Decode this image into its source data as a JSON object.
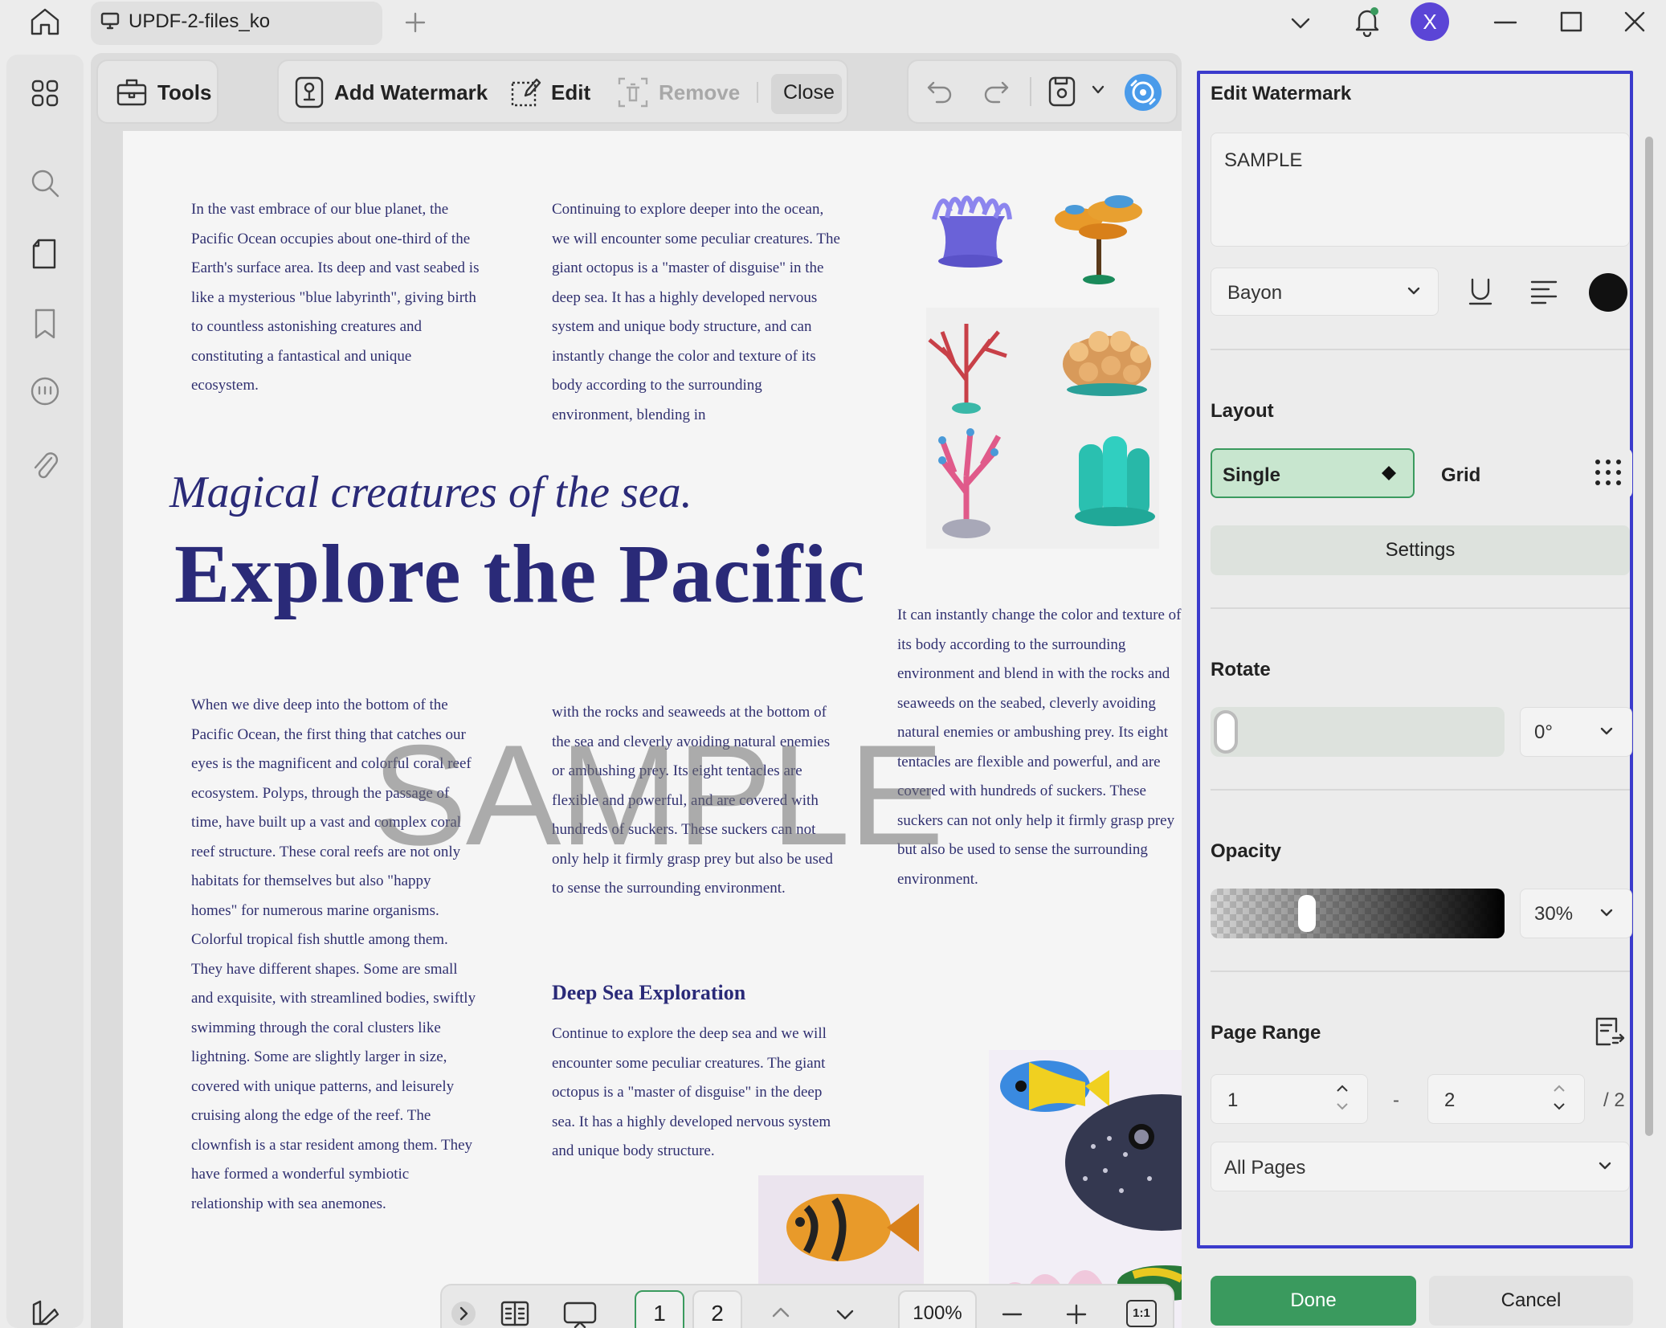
{
  "titlebar": {
    "tab_title": "UPDF-2-files_ko",
    "avatar_letter": "X"
  },
  "toolbar": {
    "tools_label": "Tools",
    "add_watermark_label": "Add Watermark",
    "edit_label": "Edit",
    "remove_label": "Remove",
    "close_label": "Close"
  },
  "document": {
    "col1_top": "In the vast embrace of our blue planet, the Pacific Ocean occupies about one-third of the Earth's surface area. Its deep and vast seabed is like a mysterious \"blue labyrinth\", giving birth to countless astonishing creatures and constituting a fantastical and unique ecosystem.",
    "col2_top": "Continuing to explore deeper into the ocean, we will encounter some peculiar creatures. The giant octopus is a \"master of disguise\" in the deep sea. It has a highly developed nervous system and unique body structure, and can instantly change the color and texture of its body according to the surrounding environment, blending in",
    "subtitle": "Magical creatures of the sea.",
    "title": "Explore the Pacific",
    "col3_mid": "It can instantly change the color and texture of its body according to the surrounding environment and blend in with the rocks and seaweeds on the seabed, cleverly avoiding natural enemies or ambushing prey. Its eight tentacles are flexible and powerful, and are covered with hundreds of suckers. These suckers can not only help it firmly grasp prey but also be used to sense the surrounding environment.",
    "col1_bottom": "When we dive deep into the bottom of the Pacific Ocean, the first thing that catches our eyes is the magnificent and colorful coral reef ecosystem. Polyps, through the passage of time, have built up a vast and complex coral reef structure. These coral reefs are not only habitats for themselves but also \"happy homes\" for numerous marine organisms. Colorful tropical fish shuttle among them. They have different shapes. Some are small and exquisite, with streamlined bodies, swiftly swimming through the coral clusters like lightning. Some are slightly larger in size, covered with unique patterns, and leisurely cruising along the edge of the reef. The clownfish is a star resident among them. They have formed a wonderful symbiotic relationship with sea anemones.",
    "col2_mid": "with the rocks and seaweeds at the bottom of the sea and cleverly avoiding natural enemies or ambushing prey. Its eight tentacles are flexible and powerful, and are covered with hundreds of suckers. These suckers can not only help it firmly grasp prey but also be used to sense the surrounding environment.",
    "section_heading": "Deep Sea Exploration",
    "col2_bottom": "Continue to explore the deep sea and we will encounter some peculiar creatures. The giant octopus is a \"master of disguise\" in the deep sea. It has a highly developed nervous system and unique body structure.",
    "watermark_text": "SAMPLE"
  },
  "bottom_bar": {
    "page1": "1",
    "page2": "2",
    "zoom": "100%",
    "fit_label": "1:1"
  },
  "panel": {
    "title": "Edit Watermark",
    "text_value": "SAMPLE",
    "font_value": "Bayon",
    "color": "#111111",
    "layout_title": "Layout",
    "layout_single": "Single",
    "layout_grid": "Grid",
    "settings_label": "Settings",
    "rotate_title": "Rotate",
    "rotate_value": "0°",
    "rotate_fraction": 0.0,
    "opacity_title": "Opacity",
    "opacity_value": "30%",
    "opacity_fraction": 0.3,
    "page_range_title": "Page Range",
    "range_from": "1",
    "range_dash": "-",
    "range_to": "2",
    "range_total": "/ 2",
    "pages_option": "All Pages",
    "done_label": "Done",
    "cancel_label": "Cancel"
  },
  "colors": {
    "accent_green": "#3a9a5e",
    "selected_green_bg": "#c8e6cf",
    "frame_blue": "#3b3bcc",
    "heading_navy": "#2a2a78",
    "avatar_purple": "#5b45d6"
  }
}
